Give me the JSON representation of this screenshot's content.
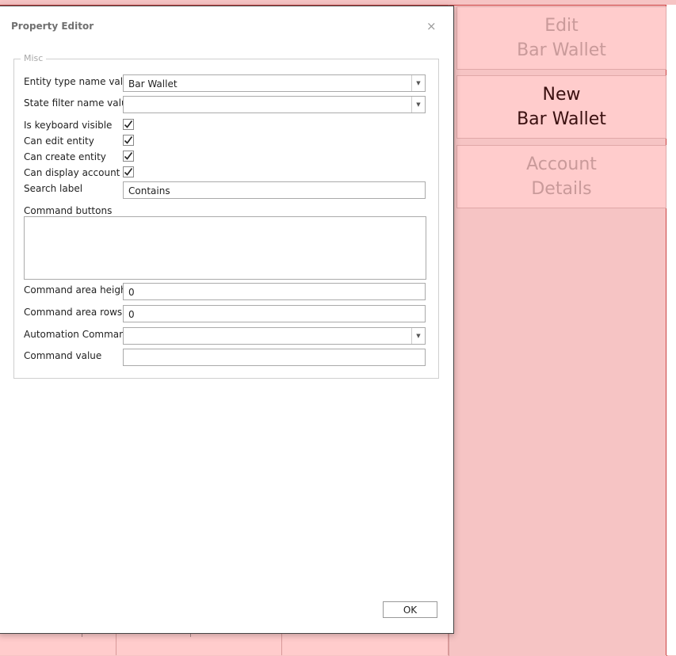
{
  "dialog": {
    "title": "Property Editor",
    "close_glyph": "×",
    "group_title": "Misc",
    "ok_label": "OK"
  },
  "fields": {
    "entity_type_label": "Entity type name value",
    "entity_type_value": "Bar Wallet",
    "state_filter_label": "State filter name value",
    "state_filter_value": "",
    "keyboard_visible_label": "Is keyboard visible",
    "keyboard_visible_checked": true,
    "can_edit_label": "Can edit entity",
    "can_edit_checked": true,
    "can_create_label": "Can create entity",
    "can_create_checked": true,
    "can_display_label": "Can display account",
    "can_display_checked": true,
    "search_label_label": "Search label",
    "search_label_value": "Contains",
    "command_buttons_label": "Command buttons",
    "command_buttons_value": "",
    "command_area_height_label": "Command area height",
    "command_area_height_value": "0",
    "command_area_rows_label": "Command area rows",
    "command_area_rows_value": "0",
    "automation_command_label": "Automation Command",
    "automation_command_value": "",
    "command_value_label": "Command value",
    "command_value_value": ""
  },
  "side_buttons": [
    {
      "line1": "Edit",
      "line2": "Bar Wallet",
      "state": "disabled"
    },
    {
      "line1": "New",
      "line2": "Bar Wallet",
      "state": "enabled"
    },
    {
      "line1": "Account",
      "line2": "Details",
      "state": "disabled"
    }
  ],
  "colors": {
    "background": "#f6c4c4",
    "side_button": "#ffcccc",
    "accent_border": "#cc4444",
    "disabled_text": "#c99a9a",
    "active_text": "#3a1010"
  }
}
